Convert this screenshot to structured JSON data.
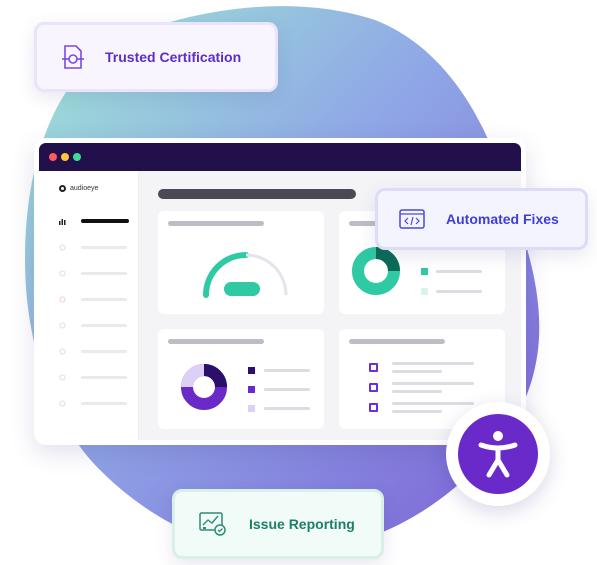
{
  "callouts": {
    "certification": {
      "label": "Trusted Certification",
      "icon": "certificate-icon"
    },
    "fixes": {
      "label": "Automated Fixes",
      "icon": "code-icon"
    },
    "issues": {
      "label": "Issue Reporting",
      "icon": "report-icon"
    }
  },
  "app": {
    "brand": "audioeye",
    "window_dots": [
      "#ff5b5b",
      "#ffc53d",
      "#3ddc97"
    ],
    "nav_icons": [
      "bar-chart-icon",
      "circle-icon",
      "circle-icon",
      "circle-icon",
      "circle-icon",
      "circle-icon",
      "circle-icon",
      "circle-icon"
    ]
  },
  "colors": {
    "accent_purple": "#6a29c9",
    "accent_teal": "#2fc9a3",
    "titlebar": "#21104a"
  },
  "badge": {
    "icon": "accessibility-icon"
  }
}
